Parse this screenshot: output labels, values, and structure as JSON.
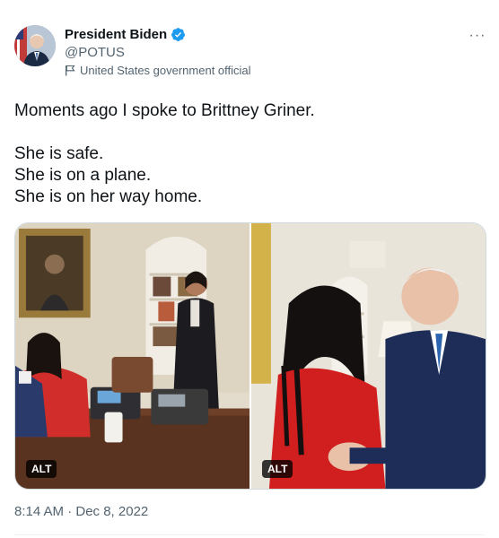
{
  "author": {
    "display_name": "President Biden",
    "handle": "@POTUS",
    "label": "United States government official",
    "verified_color": "#1d9bf0"
  },
  "tweet": {
    "lines_1": [
      "Moments ago I spoke to Brittney Griner."
    ],
    "lines_2": [
      "She is safe.",
      "She is on a plane.",
      "She is on her way home."
    ]
  },
  "media": {
    "photos": [
      {
        "alt_badge": "ALT"
      },
      {
        "alt_badge": "ALT"
      }
    ]
  },
  "meta": {
    "timestamp": "8:14 AM · Dec 8, 2022"
  },
  "icons": {
    "more": "more-options-icon",
    "verified": "verified-badge-icon",
    "government": "government-flag-icon"
  }
}
